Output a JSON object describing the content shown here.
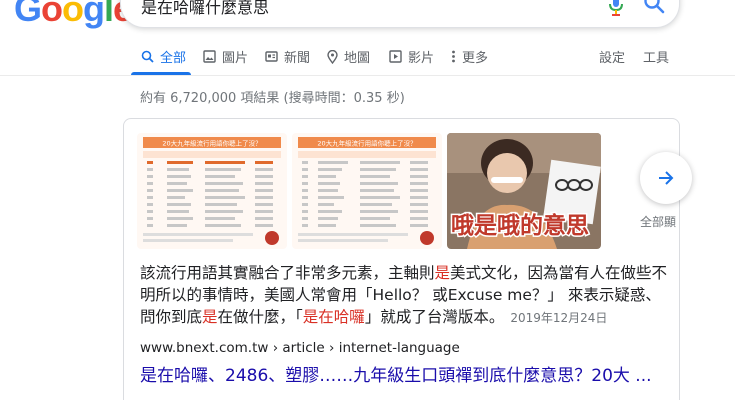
{
  "logo": {
    "letters": [
      "G",
      "o",
      "o",
      "g",
      "l",
      "e"
    ]
  },
  "search": {
    "query": "是在哈囉什麼意思"
  },
  "tabs": [
    {
      "label": "全部",
      "icon": "search-icon",
      "active": true
    },
    {
      "label": "圖片",
      "icon": "image-icon"
    },
    {
      "label": "新聞",
      "icon": "news-icon"
    },
    {
      "label": "地圖",
      "icon": "map-pin-icon"
    },
    {
      "label": "影片",
      "icon": "video-icon"
    },
    {
      "label": "更多",
      "icon": "more-vert-icon"
    }
  ],
  "tools": {
    "settings": "設定",
    "tools": "工具"
  },
  "stats": "約有 6,720,000 項結果 (搜尋時間：0.35 秒)",
  "thumbs": {
    "t1": {
      "heading": "20大九年級流行用語你聽上了沒？",
      "accent": "#f08a4b"
    },
    "t2": {
      "heading": "20大九年級流行用語你聽上了沒？",
      "accent": "#f08a4b"
    },
    "t3": {
      "caption": "哦是哦的意思",
      "accent": "#c0392b"
    }
  },
  "carousel": {
    "all_label": "全部顯"
  },
  "snippet": {
    "p1": "該流行用語其實融合了非常多元素，主軸則",
    "h1": "是",
    "p2": "美式文化，因為當有人在做些不明所以的事情時，美國人常會用「Hello？ 或Excuse me？」 來表示疑惑、問你到底",
    "h2": "是",
    "p3": "在做什麼，「",
    "h3": "是在哈囉",
    "p4": "」就成了台灣版本。",
    "date": "2019年12月24日"
  },
  "result": {
    "url": "www.bnext.com.tw › article › internet-language",
    "title": "是在哈囉、2486、塑膠……九年級生口頭禪到底什麼意思？20大 ..."
  },
  "colors": {
    "link": "#1a0dab",
    "accent_blue": "#1a73e8",
    "highlight": "#d93025"
  }
}
